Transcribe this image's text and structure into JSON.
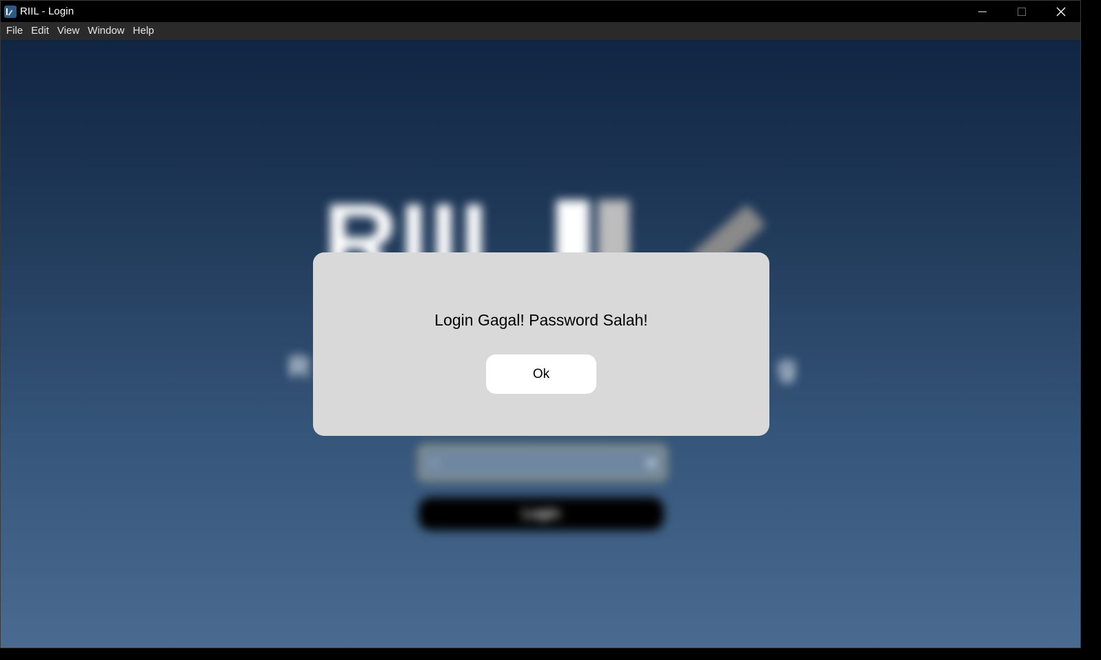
{
  "window": {
    "title": "RIIL - Login",
    "controls": [
      "minimize-icon",
      "maximize-icon",
      "close-icon"
    ]
  },
  "menu": {
    "items": [
      "File",
      "Edit",
      "View",
      "Window",
      "Help"
    ]
  },
  "background": {
    "logo_text": "RIIL",
    "tagline_start": "R",
    "tagline_end": "g",
    "password_field_icon_left": "key-icon",
    "password_field_icon_right": "eye-icon",
    "login_button_label": "Login",
    "gradient_colors": [
      "#102542",
      "#4a6b8f"
    ]
  },
  "dialog": {
    "message": "Login Gagal! Password Salah!",
    "ok_label": "Ok",
    "background_color": "#d9d9d9"
  }
}
